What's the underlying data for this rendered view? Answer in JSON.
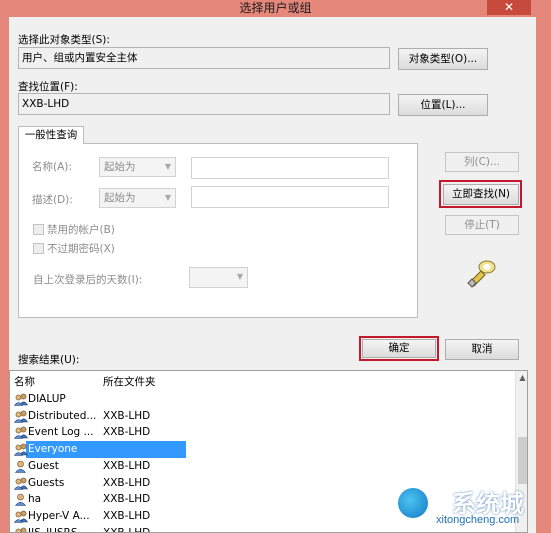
{
  "window": {
    "title": "选择用户或组",
    "close_glyph": "✕"
  },
  "object_type": {
    "label": "选择此对象类型(S):",
    "value": "用户、组或内置安全主体",
    "button": "对象类型(O)..."
  },
  "location": {
    "label": "查找位置(F):",
    "value": "XXB-LHD",
    "button": "位置(L)..."
  },
  "common_query": {
    "tab": "一般性查询",
    "name_label": "名称(A):",
    "name_mode": "起始为",
    "description_label": "描述(D):",
    "description_mode": "起始为",
    "disabled_accounts": "禁用的帐户(B)",
    "non_expiring_password": "不过期密码(X)",
    "days_since_logon_label": "自上次登录后的天数(I):"
  },
  "buttons": {
    "columns": "列(C)...",
    "find_now": "立即查找(N)",
    "stop": "停止(T)",
    "ok": "确定",
    "cancel": "取消"
  },
  "results": {
    "label": "搜索结果(U):",
    "columns": [
      "名称",
      "所在文件夹"
    ],
    "rows": [
      {
        "name": "DIALUP",
        "folder": "",
        "icon": "group-icon",
        "selected": false
      },
      {
        "name": "Distributed...",
        "folder": "XXB-LHD",
        "icon": "group-icon",
        "selected": false
      },
      {
        "name": "Event Log ...",
        "folder": "XXB-LHD",
        "icon": "group-icon",
        "selected": false
      },
      {
        "name": "Everyone",
        "folder": "",
        "icon": "group-icon",
        "selected": true
      },
      {
        "name": "Guest",
        "folder": "XXB-LHD",
        "icon": "user-icon",
        "selected": false
      },
      {
        "name": "Guests",
        "folder": "XXB-LHD",
        "icon": "group-icon",
        "selected": false
      },
      {
        "name": "ha",
        "folder": "XXB-LHD",
        "icon": "user-icon",
        "selected": false
      },
      {
        "name": "Hyper-V A...",
        "folder": "XXB-LHD",
        "icon": "group-icon",
        "selected": false
      },
      {
        "name": "IIS_IUSRS",
        "folder": "XXB-LHD",
        "icon": "group-icon",
        "selected": false
      }
    ]
  },
  "watermark": {
    "brand": "系统城",
    "url": "xitongcheng.com"
  },
  "colors": {
    "frame": "#e5877a",
    "highlight_border": "#c4182c",
    "selection": "#3399ff"
  }
}
